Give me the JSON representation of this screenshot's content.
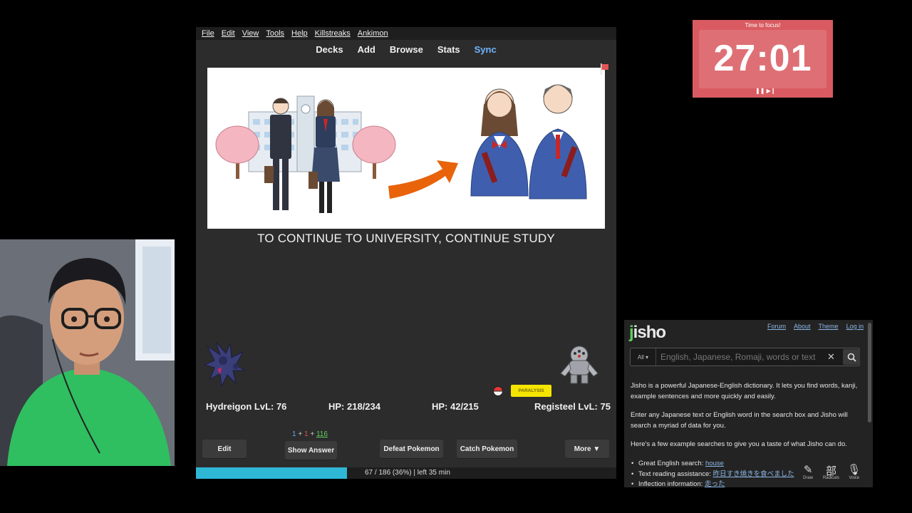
{
  "anki": {
    "menu": [
      "File",
      "Edit",
      "View",
      "Tools",
      "Help",
      "Killstreaks",
      "Ankimon"
    ],
    "nav": [
      "Decks",
      "Add",
      "Browse",
      "Stats",
      "Sync"
    ],
    "card_text": "TO CONTINUE TO UNIVERSITY, CONTINUE STUDY",
    "battle": {
      "player_name": "Hydreigon LvL: 76",
      "player_hp": "HP: 218/234",
      "enemy_hp": "HP: 42/215",
      "enemy_name": "Registeel LvL: 75",
      "status": "PARALYSIS"
    },
    "counts": {
      "new": "1",
      "plus1": "+",
      "learn": "1",
      "plus2": "+",
      "review": "116"
    },
    "buttons": {
      "edit": "Edit",
      "show_answer": "Show Answer",
      "defeat": "Defeat Pokemon",
      "catch": "Catch Pokemon",
      "more": "More ▼"
    },
    "progress": {
      "fraction": 0.36,
      "text": "67 / 186 (36%) | left 35 min"
    },
    "colors": {
      "accent": "#2fb7d6",
      "sync": "#6fb6ff",
      "status": "#f4e400"
    }
  },
  "timer": {
    "label": "Time to focus!",
    "value": "27:01",
    "controls": "❚❚ ▶❙",
    "color": "#d95b61"
  },
  "jisho": {
    "logo_j": "j",
    "logo_rest": "isho",
    "links": [
      "Forum",
      "About",
      "Theme",
      "Log in"
    ],
    "filter": "All ▾",
    "placeholder": "English, Japanese, Romaji, words or text",
    "clear": "✕",
    "para1": "Jisho is a powerful Japanese-English dictionary. It lets you find words, kanji, example sentences and more quickly and easily.",
    "para2": "Enter any Japanese text or English word in the search box and Jisho will search a myriad of data for you.",
    "para3": "Here's a few example searches to give you a taste of what Jisho can do.",
    "examples": [
      {
        "label": "Great English search: ",
        "link": "house"
      },
      {
        "label": "Text reading assistance: ",
        "link": "昨日すき焼きを食べました"
      },
      {
        "label": "Inflection information: ",
        "link": "走った"
      }
    ],
    "tools": [
      {
        "glyph": "✎",
        "label": "Draw"
      },
      {
        "glyph": "部",
        "label": "Radicals"
      },
      {
        "glyph": "🎙",
        "label": "Voice"
      }
    ]
  }
}
